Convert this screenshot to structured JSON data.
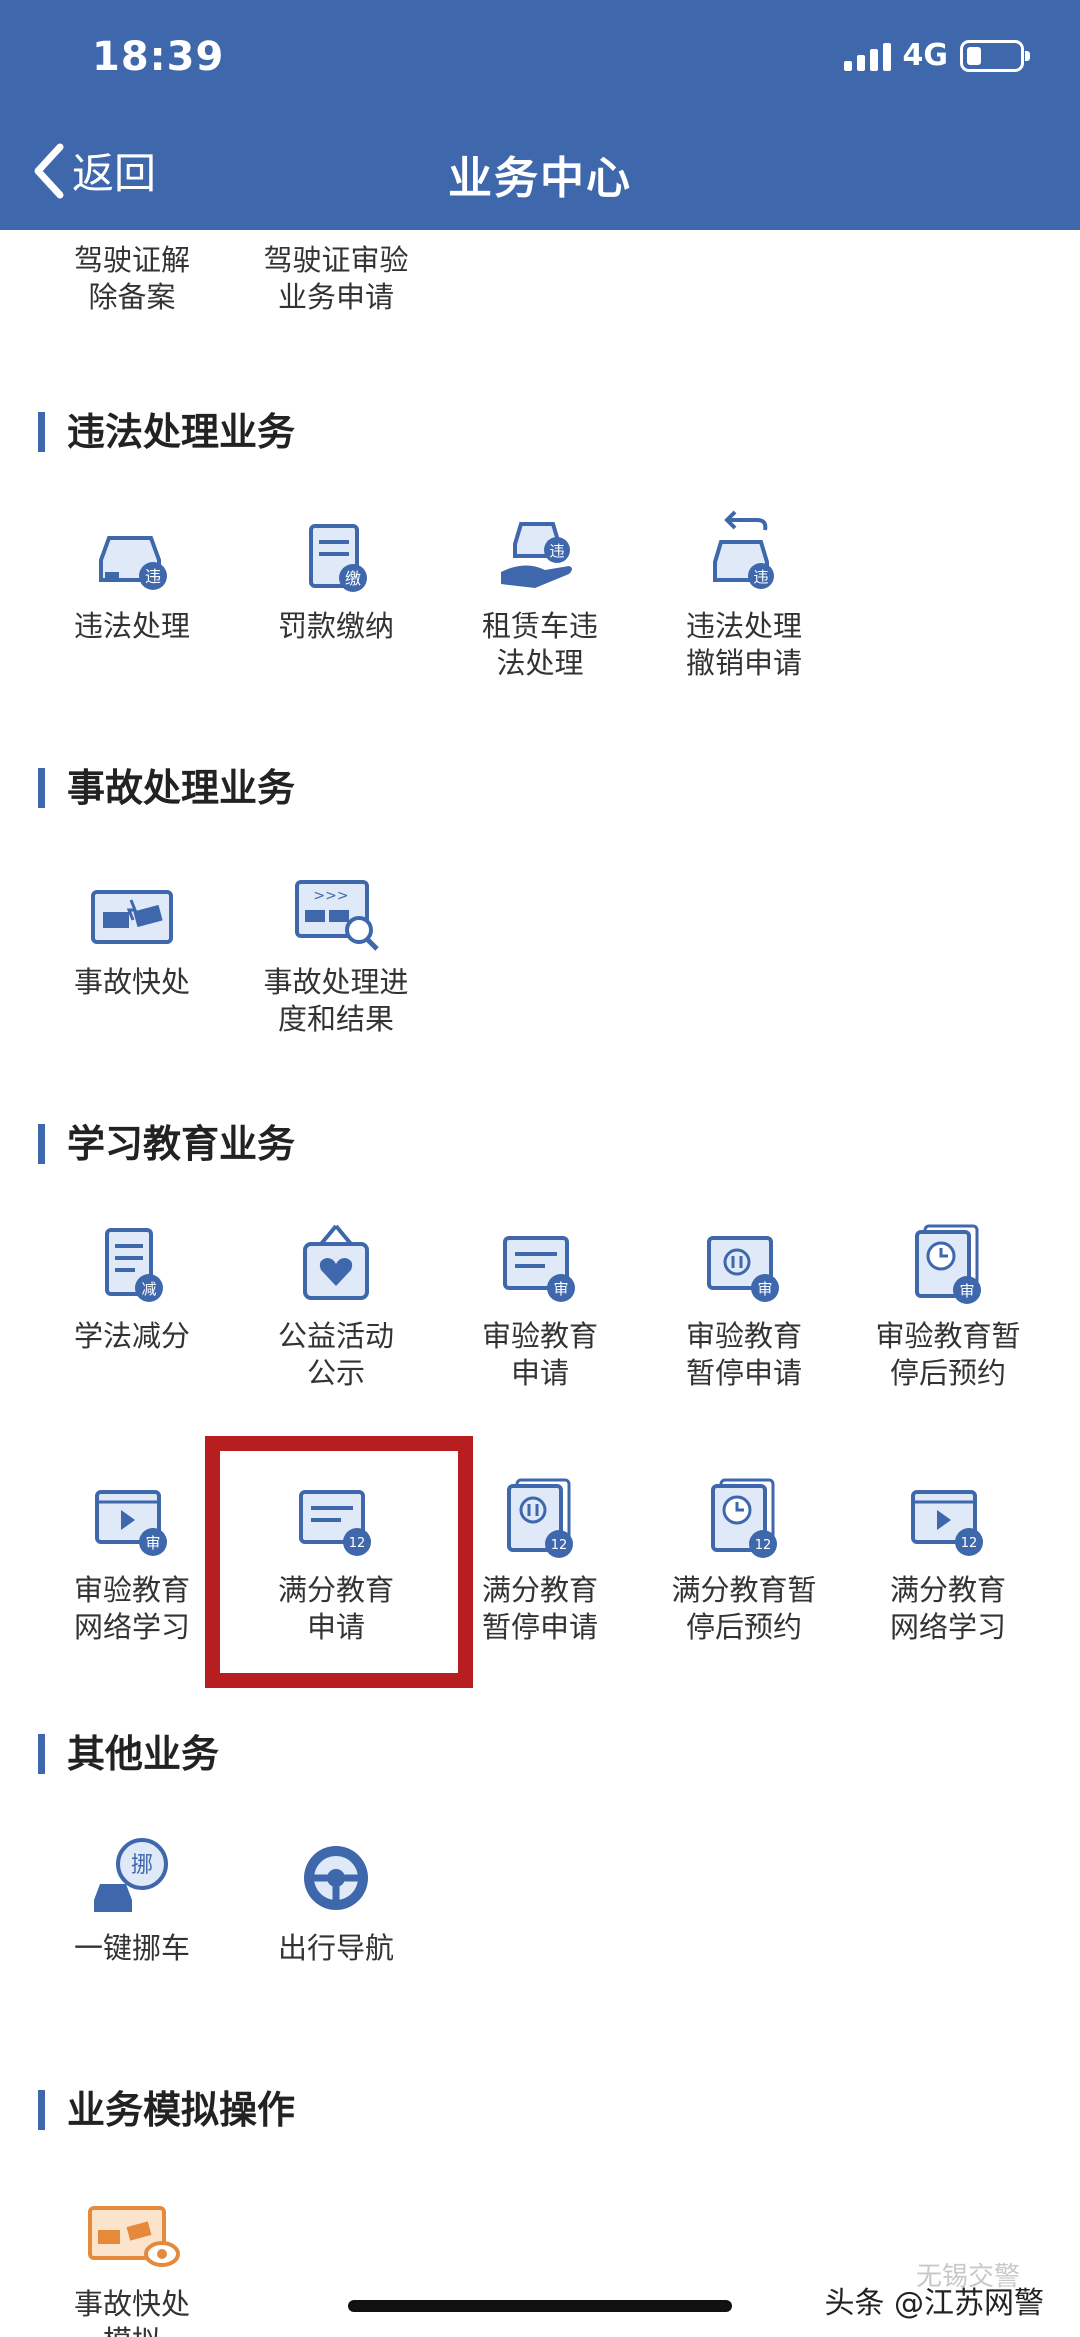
{
  "status": {
    "time": "18:39",
    "network": "4G"
  },
  "nav": {
    "back_label": "返回",
    "title": "业务中心"
  },
  "top_items": [
    {
      "label": "驾驶证解\n除备案"
    },
    {
      "label": "驾驶证审验\n业务申请"
    }
  ],
  "sections": {
    "violation": {
      "title": "违法处理业务",
      "items": [
        {
          "label": "违法处理",
          "icon": "car-violation-icon"
        },
        {
          "label": "罚款缴纳",
          "icon": "fine-payment-icon"
        },
        {
          "label": "租赁车违\n法处理",
          "icon": "rental-car-violation-icon"
        },
        {
          "label": "违法处理\n撤销申请",
          "icon": "violation-revoke-icon"
        }
      ]
    },
    "accident": {
      "title": "事故处理业务",
      "items": [
        {
          "label": "事故快处",
          "icon": "accident-quick-icon"
        },
        {
          "label": "事故处理进\n度和结果",
          "icon": "accident-progress-icon"
        }
      ]
    },
    "education": {
      "title": "学习教育业务",
      "items": [
        {
          "label": "学法减分",
          "icon": "study-reduce-points-icon",
          "badge": "减"
        },
        {
          "label": "公益活动\n公示",
          "icon": "public-welfare-icon"
        },
        {
          "label": "审验教育\n申请",
          "icon": "review-education-icon",
          "badge": "审"
        },
        {
          "label": "审验教育\n暂停申请",
          "icon": "review-pause-icon",
          "badge": "审"
        },
        {
          "label": "审验教育暂\n停后预约",
          "icon": "review-appointment-icon",
          "badge": "审"
        },
        {
          "label": "审验教育\n网络学习",
          "icon": "review-online-icon",
          "badge": "审"
        },
        {
          "label": "满分教育\n申请",
          "icon": "full-score-education-icon",
          "badge": "12"
        },
        {
          "label": "满分教育\n暂停申请",
          "icon": "full-score-pause-icon",
          "badge": "12"
        },
        {
          "label": "满分教育暂\n停后预约",
          "icon": "full-score-appointment-icon",
          "badge": "12"
        },
        {
          "label": "满分教育\n网络学习",
          "icon": "full-score-online-icon",
          "badge": "12"
        }
      ]
    },
    "other": {
      "title": "其他业务",
      "items": [
        {
          "label": "一键挪车",
          "icon": "move-car-icon",
          "badge": "挪"
        },
        {
          "label": "出行导航",
          "icon": "navigation-icon"
        }
      ]
    },
    "simulation": {
      "title": "业务模拟操作",
      "items": [
        {
          "label": "事故快处\n模拟",
          "icon": "accident-simulation-icon"
        }
      ]
    }
  },
  "watermark": {
    "text": "头条 @江苏网警",
    "faint": "无锡交警"
  },
  "colors": {
    "brand": "#3e67ac",
    "highlight": "#b81d1f",
    "simulation": "#e58a3a"
  }
}
